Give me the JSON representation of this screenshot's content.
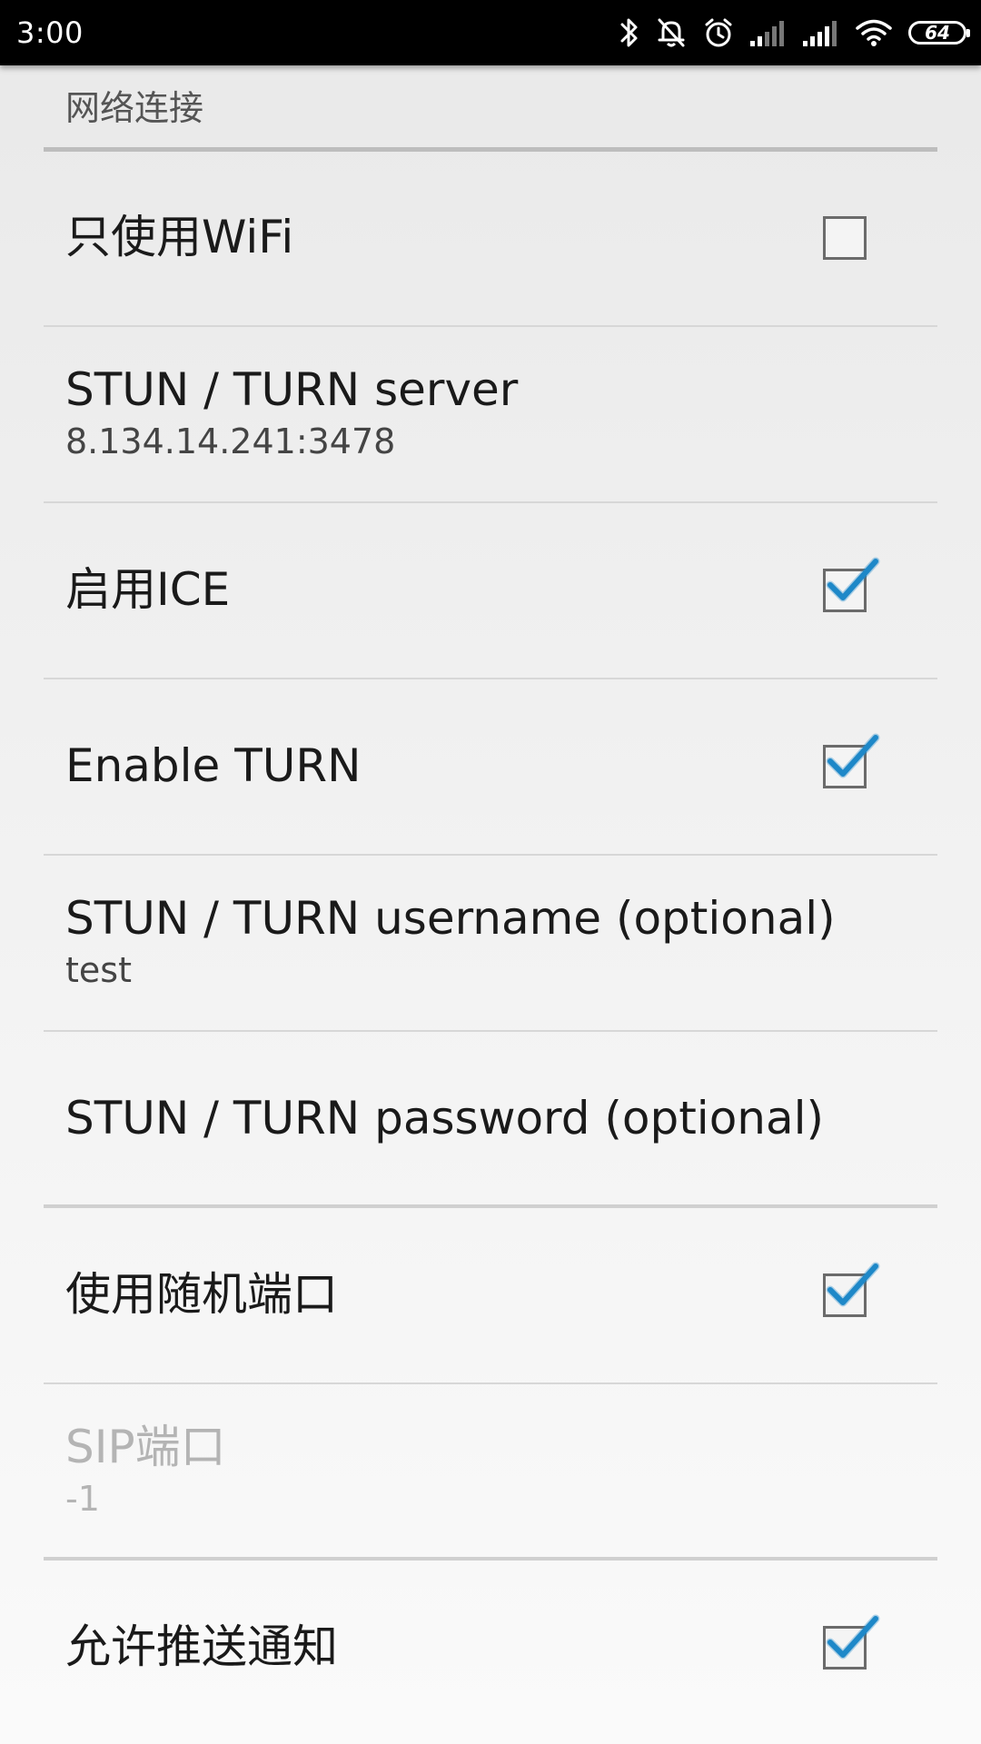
{
  "status_bar": {
    "time": "3:00",
    "battery": "64",
    "icons": [
      "bluetooth-icon",
      "notifications-off-icon",
      "alarm-icon",
      "signal-icon",
      "signal-icon",
      "wifi-icon",
      "battery-icon"
    ]
  },
  "category": {
    "title": "网络连接"
  },
  "preferences": [
    {
      "title": "只使用WiFi",
      "checkbox": true,
      "checked": false
    },
    {
      "title": "STUN / TURN server",
      "summary": "8.134.14.241:3478"
    },
    {
      "title": "启用ICE",
      "checkbox": true,
      "checked": true
    },
    {
      "title": "Enable TURN",
      "checkbox": true,
      "checked": true
    },
    {
      "title": "STUN / TURN username (optional)",
      "summary": "test"
    },
    {
      "title": "STUN / TURN password (optional)"
    },
    {
      "title": "使用随机端口",
      "checkbox": true,
      "checked": true
    },
    {
      "title": "SIP端口",
      "summary": "-1",
      "enabled": false
    },
    {
      "title": "允许推送通知",
      "checkbox": true,
      "checked": true
    }
  ],
  "colors": {
    "check_mark": "#1e88c8",
    "status_bar": "#000000",
    "background_top": "#e9e9e9",
    "background_bottom": "#fafafa"
  }
}
